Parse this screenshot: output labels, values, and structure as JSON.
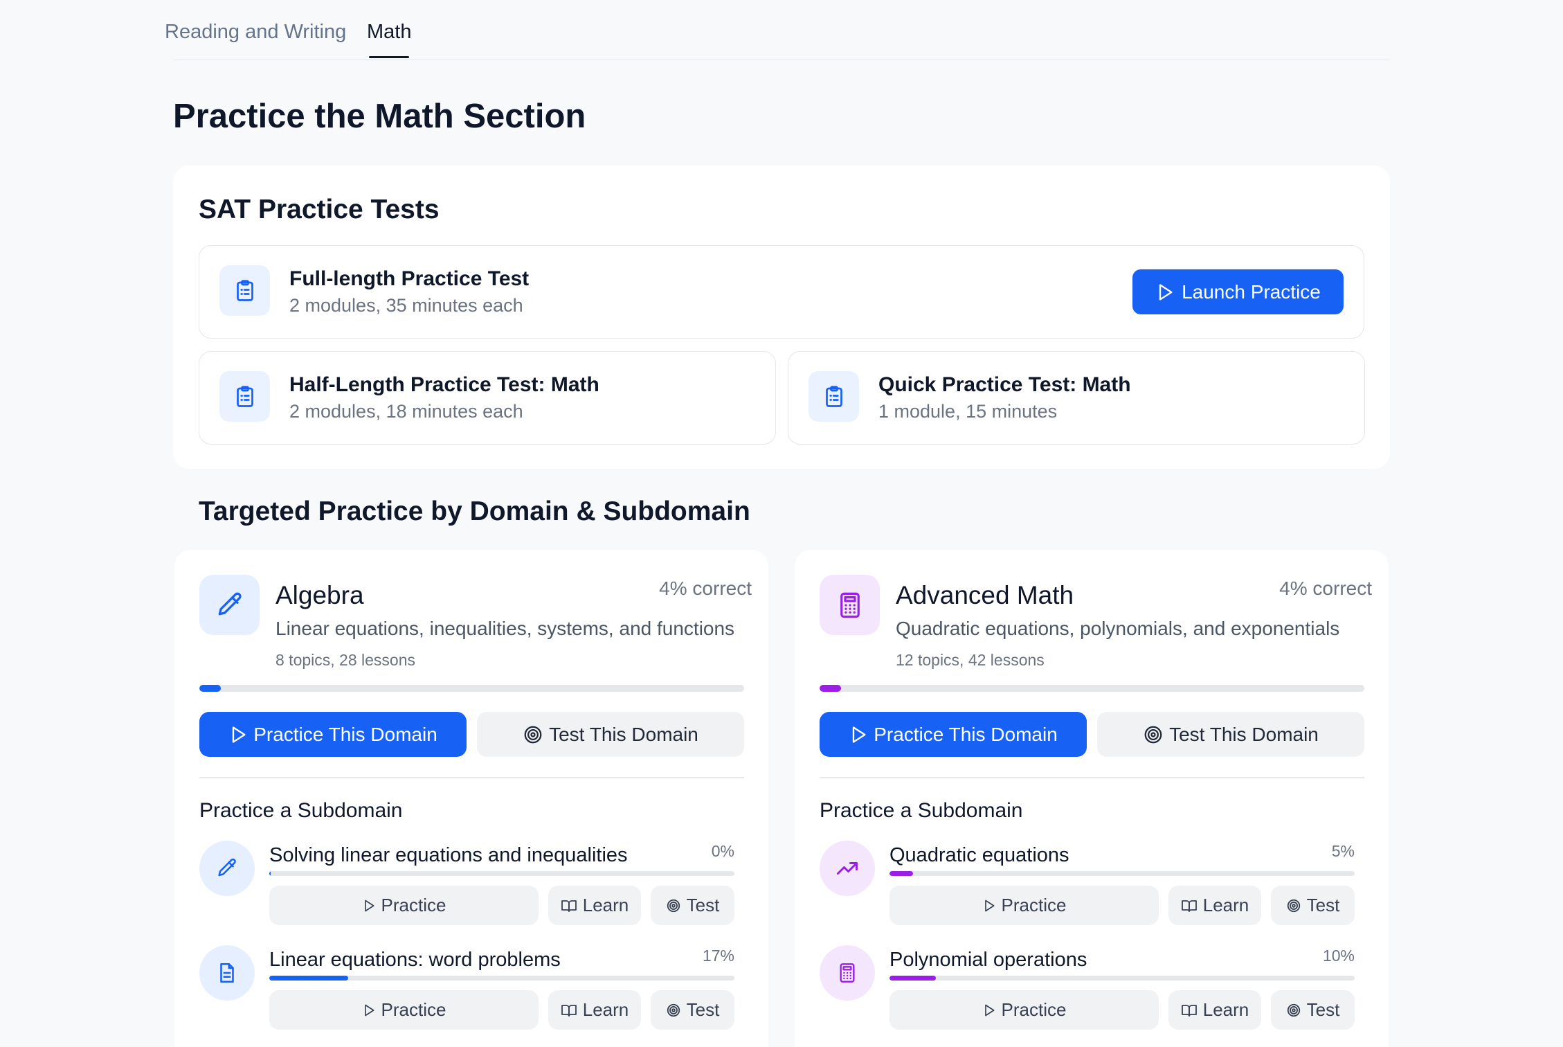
{
  "tabs": [
    {
      "label": "Reading and Writing",
      "active": false
    },
    {
      "label": "Math",
      "active": true
    }
  ],
  "page_title": "Practice the Math Section",
  "practice_tests": {
    "title": "SAT Practice Tests",
    "tests": [
      {
        "name": "Full-length Practice Test",
        "desc": "2 modules, 35 minutes each",
        "icon": "clipboard-list-icon"
      },
      {
        "name": "Half-Length Practice Test: Math",
        "desc": "2 modules, 18 minutes each",
        "icon": "clipboard-list-icon"
      },
      {
        "name": "Quick Practice Test: Math",
        "desc": "1 module, 15 minutes",
        "icon": "clipboard-list-icon"
      }
    ],
    "launch_label": "Launch Practice"
  },
  "targeted_title": "Targeted Practice by Domain & Subdomain",
  "colors": {
    "blue": "#1861f5",
    "purple": "#9b1ee6"
  },
  "domains": [
    {
      "name": "Algebra",
      "correct": "4% correct",
      "desc": "Linear equations, inequalities, systems, and functions",
      "meta": "8 topics, 28 lessons",
      "progress": 0.04,
      "icon": "pencil-icon",
      "practice_label": "Practice This Domain",
      "test_label": "Test This Domain",
      "sub_heading": "Practice a Subdomain",
      "subdomains": [
        {
          "name": "Solving linear equations and inequalities",
          "pct": "0%",
          "progress": 0.0,
          "icon": "pencil-icon"
        },
        {
          "name": "Linear equations: word problems",
          "pct": "17%",
          "progress": 0.17,
          "icon": "document-icon"
        }
      ]
    },
    {
      "name": "Advanced Math",
      "correct": "4% correct",
      "desc": "Quadratic equations, polynomials, and exponentials",
      "meta": "12 topics, 42 lessons",
      "progress": 0.04,
      "icon": "calculator-icon",
      "practice_label": "Practice This Domain",
      "test_label": "Test This Domain",
      "sub_heading": "Practice a Subdomain",
      "subdomains": [
        {
          "name": "Quadratic equations",
          "pct": "5%",
          "progress": 0.05,
          "icon": "trending-up-icon"
        },
        {
          "name": "Polynomial operations",
          "pct": "10%",
          "progress": 0.1,
          "icon": "calculator-icon"
        }
      ]
    }
  ],
  "sub_buttons": {
    "practice": "Practice",
    "learn": "Learn",
    "test": "Test"
  }
}
